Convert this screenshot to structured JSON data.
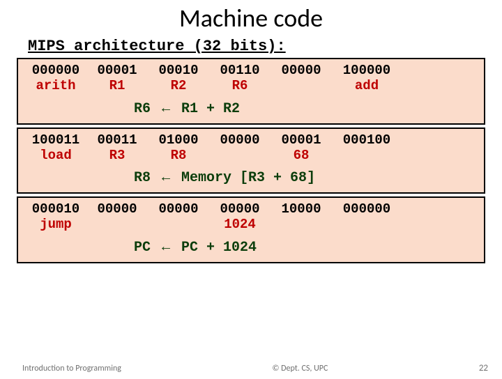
{
  "title": "Machine code",
  "subtitle": "MIPS architecture (32 bits):",
  "instructions": [
    {
      "bits": [
        "000000",
        "00001",
        "00010",
        "00110",
        "00000",
        "100000"
      ],
      "labels": [
        "arith",
        "R1",
        "R2",
        "R6",
        "",
        "add"
      ],
      "semantic_parts": {
        "dest": "R6",
        "arrow": "←",
        "rest": "R1 + R2"
      }
    },
    {
      "bits": [
        "100011",
        "00011",
        "01000",
        "00000",
        "00001",
        "000100"
      ],
      "labels": [
        "load",
        "R3",
        "R8",
        "",
        "68",
        ""
      ],
      "semantic_parts": {
        "dest": "R8",
        "arrow": "←",
        "rest": "Memory [R3 + 68]"
      }
    },
    {
      "bits": [
        "000010",
        "00000",
        "00000",
        "00000",
        "10000",
        "000000"
      ],
      "labels": [
        "jump",
        "",
        "",
        "1024",
        "",
        ""
      ],
      "semantic_parts": {
        "dest": "PC",
        "arrow": "←",
        "rest": "PC + 1024"
      }
    }
  ],
  "col_widths": [
    "88px",
    "88px",
    "88px",
    "88px",
    "88px",
    "100px"
  ],
  "footer": {
    "left": "Introduction to Programming",
    "center": "© Dept. CS, UPC",
    "page": "22"
  }
}
